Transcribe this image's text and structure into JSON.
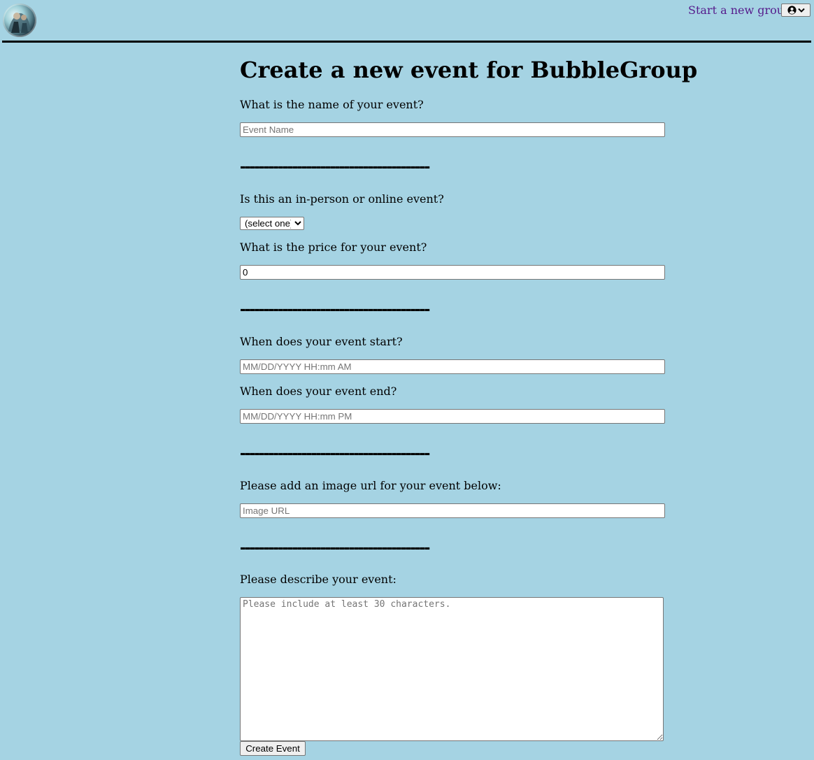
{
  "nav": {
    "new_group_link": "Start a new group",
    "profile_button_icons": [
      "user-circle-icon",
      "chevron-down-icon"
    ],
    "logo_icon": "group-logo-image"
  },
  "form": {
    "title": "Create a new event for BubbleGroup",
    "name_label": "What is the name of your event?",
    "name_placeholder": "Event Name",
    "divider_text": "----------------------------------------",
    "type_label": "Is this an in-person or online event?",
    "type_selected": "(select one)",
    "price_label": "What is the price for your event?",
    "price_value": "0",
    "start_label": "When does your event start?",
    "start_placeholder": "MM/DD/YYYY HH:mm AM",
    "end_label": "When does your event end?",
    "end_placeholder": "MM/DD/YYYY HH:mm PM",
    "image_label": "Please add an image url for your event below:",
    "image_placeholder": "Image URL",
    "description_label": "Please describe your event:",
    "description_placeholder": "Please include at least 30 characters.",
    "submit_label": "Create Event"
  },
  "colors": {
    "background": "#a5d3e3",
    "link": "#551a8b"
  }
}
